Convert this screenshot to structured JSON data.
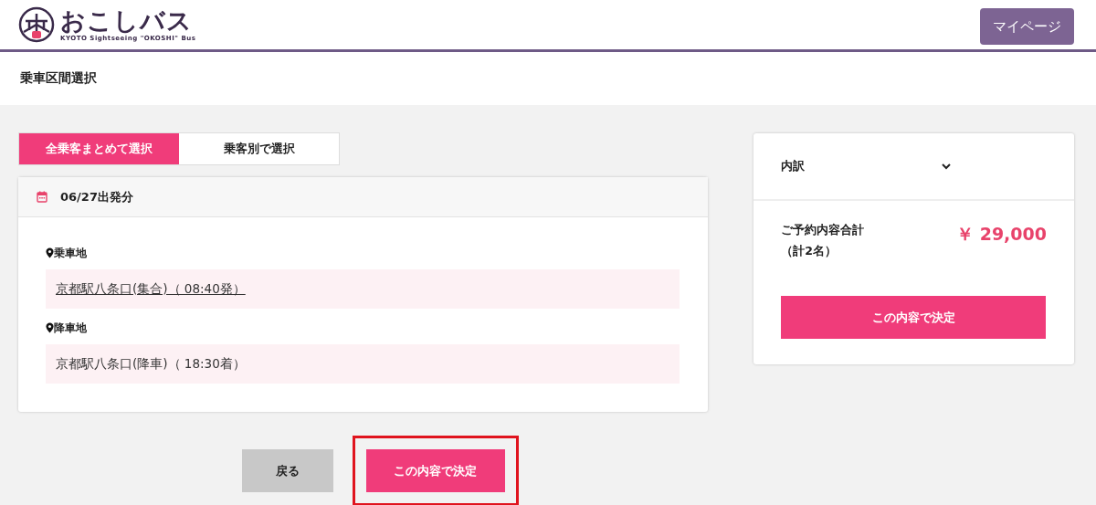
{
  "header": {
    "logo_text": "おこしバス",
    "logo_subtitle": "KYOTO Sightseeing \"OKOSHI\" Bus",
    "mypage_button": "マイページ"
  },
  "page_title": "乗車区間選択",
  "tabs": [
    {
      "label": "全乗客まとめて選択",
      "selected": true
    },
    {
      "label": "乗客別で選択",
      "selected": false
    }
  ],
  "route_card": {
    "date_heading": "06/27出発分",
    "sections": [
      {
        "label": "乗車地",
        "value": "京都駅八条口(集合)（ 08:40発）",
        "link": true
      },
      {
        "label": "降車地",
        "value": "京都駅八条口(降車)（ 18:30着）",
        "link": false
      }
    ]
  },
  "summary": {
    "breakdown_label": "内訳",
    "expanded": false,
    "total_label": "ご予約内容合計",
    "count_label": "（計2名）",
    "total": "￥ 29,000",
    "confirm_button": "この内容で決定"
  },
  "footer_buttons": [
    {
      "kind": "back",
      "label": "戻る",
      "highlighted": false
    },
    {
      "kind": "confirm",
      "label": "この内容で決定",
      "highlighted": true
    }
  ]
}
